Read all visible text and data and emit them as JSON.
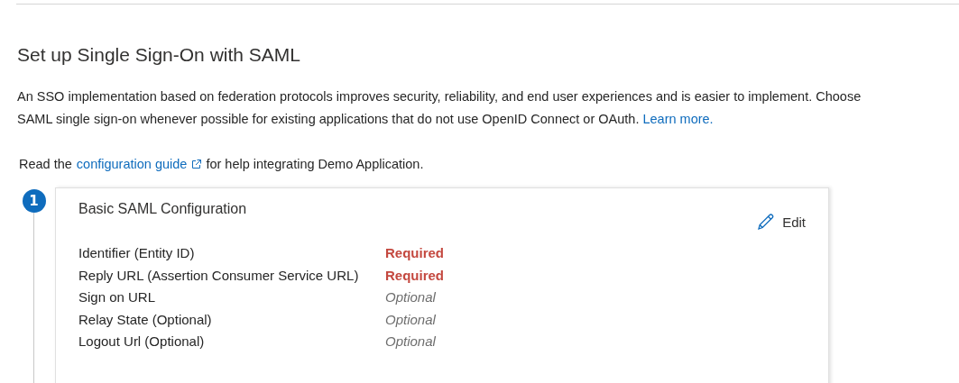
{
  "title": "Set up Single Sign-On with SAML",
  "description": {
    "text": "An SSO implementation based on federation protocols improves security, reliability, and end user experiences and is easier to implement. Choose SAML single sign-on whenever possible for existing applications that do not use OpenID Connect or OAuth.",
    "link": "Learn more."
  },
  "guide": {
    "before": "Read the",
    "link": "configuration guide",
    "after": "for help integrating Demo Application."
  },
  "steps": [
    {
      "number": "1",
      "title": "Basic SAML Configuration",
      "edit": "Edit",
      "fields": [
        {
          "label": "Identifier (Entity ID)",
          "value": "Required",
          "kind": "required"
        },
        {
          "label": "Reply URL (Assertion Consumer Service URL)",
          "value": "Required",
          "kind": "required"
        },
        {
          "label": "Sign on URL",
          "value": "Optional",
          "kind": "optional"
        },
        {
          "label": "Relay State (Optional)",
          "value": "Optional",
          "kind": "optional"
        },
        {
          "label": "Logout Url (Optional)",
          "value": "Optional",
          "kind": "optional"
        }
      ]
    }
  ]
}
